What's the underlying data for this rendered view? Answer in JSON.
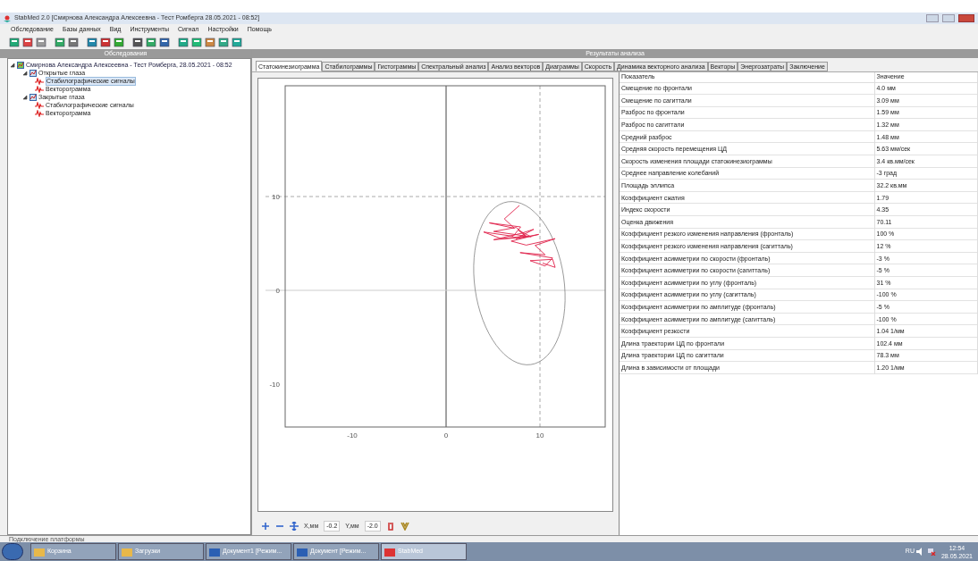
{
  "window": {
    "title": "StabMed 2.0 [Смирнова Александра Алексеевна - Тест Ромберга 28.05.2021 - 08:52]"
  },
  "menu": [
    "Обследование",
    "Базы данных",
    "Вид",
    "Инструменты",
    "Сигнал",
    "Настройки",
    "Помощь"
  ],
  "left_panel": {
    "title": "Обследования",
    "tree": [
      {
        "label": "Смирнова Александра Алексеевна - Тест Ромберга, 28.05.2021 - 08:52",
        "expanded": true,
        "selected": false,
        "children": [
          {
            "label": "Открытые глаза",
            "expanded": true,
            "selected": false,
            "children": [
              {
                "label": "Стабилографические сигналы",
                "selected": true
              },
              {
                "label": "Векторограмма",
                "selected": false
              }
            ]
          },
          {
            "label": "Закрытые глаза",
            "expanded": true,
            "selected": false,
            "children": [
              {
                "label": "Стабилографические сигналы",
                "selected": false
              },
              {
                "label": "Векторограмма",
                "selected": false
              }
            ]
          }
        ]
      }
    ]
  },
  "right_panel": {
    "title": "Результаты анализа",
    "tabs": [
      {
        "label": "Статокинезиограмма",
        "selected": true
      },
      {
        "label": "Стабилограммы",
        "selected": false
      },
      {
        "label": "Гистограммы",
        "selected": false
      },
      {
        "label": "Спектральный анализ",
        "selected": false
      },
      {
        "label": "Анализ векторов",
        "selected": false
      },
      {
        "label": "Диаграммы",
        "selected": false
      },
      {
        "label": "Скорость",
        "selected": false
      },
      {
        "label": "Динамика векторного анализа",
        "selected": false
      },
      {
        "label": "Векторы",
        "selected": false
      },
      {
        "label": "Энергозатраты",
        "selected": false
      },
      {
        "label": "Заключение",
        "selected": false
      }
    ],
    "plot": {
      "y_ticks": [
        "10",
        "0",
        "-10"
      ],
      "x_ticks": [
        "-10",
        "0",
        "10"
      ]
    },
    "plot_toolbar": {
      "x_label": "X,мм",
      "x_value": "-0.2",
      "y_label": "Y,мм",
      "y_value": "-2.0"
    },
    "table": {
      "columns": [
        "Показатель",
        "Значение"
      ],
      "rows": [
        [
          "Смещение по фронтали",
          "4.0 мм"
        ],
        [
          "Смещение по сагиттали",
          "3.09 мм"
        ],
        [
          "Разброс по фронтали",
          "1.59 мм"
        ],
        [
          "Разброс по сагиттали",
          "1.32 мм"
        ],
        [
          "Средний разброс",
          "1.48 мм"
        ],
        [
          "Средняя скорость перемещения ЦД",
          "5.63 мм/сек"
        ],
        [
          "Скорость изменения площади статокинезиограммы",
          "3.4 кв.мм/сек"
        ],
        [
          "Среднее направление колебаний",
          "-3 град"
        ],
        [
          "Площадь эллипса",
          "32.2 кв.мм"
        ],
        [
          "Коэффициент сжатия",
          "1.79"
        ],
        [
          "Индекс скорости",
          "4.35"
        ],
        [
          "Оценка движения",
          "70.11"
        ],
        [
          "Коэффициент резкого изменения направления (фронталь)",
          "100 %"
        ],
        [
          "Коэффициент резкого изменения направления (сагитталь)",
          "12 %"
        ],
        [
          "Коэффициент асимметрии по скорости (фронталь)",
          "-3 %"
        ],
        [
          "Коэффициент асимметрии по скорости (сагитталь)",
          "-5 %"
        ],
        [
          "Коэффициент асимметрии по углу (фронталь)",
          "31 %"
        ],
        [
          "Коэффициент асимметрии по углу (сагитталь)",
          "-100 %"
        ],
        [
          "Коэффициент асимметрии по амплитуде (фронталь)",
          "-5 %"
        ],
        [
          "Коэффициент асимметрии по амплитуде (сагитталь)",
          "-100 %"
        ],
        [
          "Коэффициент резкости",
          "1.04 1/мм"
        ],
        [
          "Длина траектории ЦД по фронтали",
          "102.4 мм"
        ],
        [
          "Длина траектории ЦД по сагиттали",
          "78.3 мм"
        ],
        [
          "Длина в зависимости от площади",
          "1.20 1/мм"
        ]
      ]
    }
  },
  "status_bar": "Подключение платформы",
  "taskbar": {
    "items": [
      {
        "label": "Корзина",
        "kind": "folder",
        "active": false
      },
      {
        "label": "Загрузки",
        "kind": "folder",
        "active": false
      },
      {
        "label": "Документ1 [Режим...",
        "kind": "word",
        "active": false
      },
      {
        "label": "Документ [Режим...",
        "kind": "word",
        "active": false
      },
      {
        "label": "StabMed",
        "kind": "app",
        "active": true
      }
    ],
    "language": "RU",
    "time": "12:54",
    "date": "28.05.2021"
  }
}
